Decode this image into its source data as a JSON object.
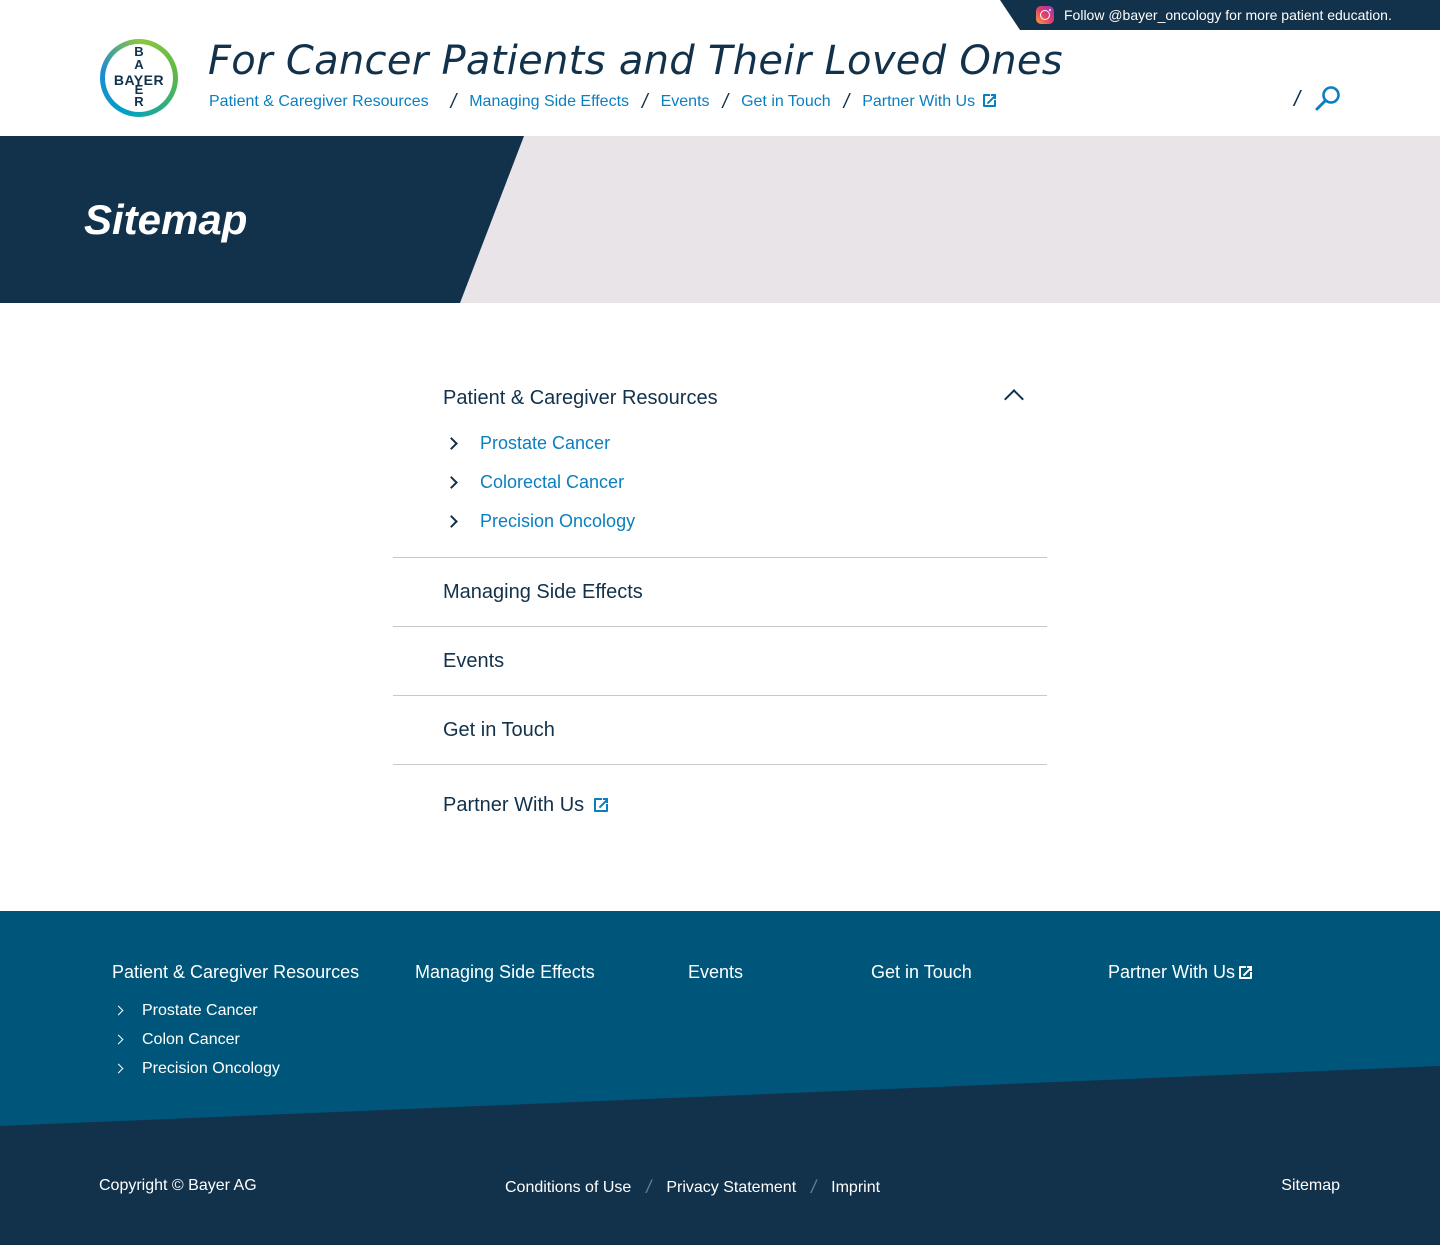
{
  "social": {
    "text": "Follow @bayer_oncology for more patient education."
  },
  "logo": {
    "horizontal": "BAYER",
    "vertical": "B A Y E R"
  },
  "site_title": "For Cancer Patients and Their Loved Ones",
  "nav": {
    "items": [
      "Patient & Caregiver Resources",
      "Managing Side Effects",
      "Events",
      "Get in Touch",
      "Partner With Us"
    ],
    "separator": "/"
  },
  "hero": {
    "title": "Sitemap"
  },
  "sitemap": {
    "sections": [
      {
        "title": "Patient & Caregiver Resources",
        "expanded": true,
        "children": [
          "Prostate Cancer",
          "Colorectal Cancer",
          "Precision Oncology"
        ]
      },
      {
        "title": "Managing Side Effects"
      },
      {
        "title": "Events"
      },
      {
        "title": "Get in Touch"
      },
      {
        "title": "Partner With Us",
        "external": true
      }
    ]
  },
  "footer": {
    "columns": [
      "Patient & Caregiver Resources",
      "Managing Side Effects",
      "Events",
      "Get in Touch",
      "Partner With Us"
    ],
    "resources_children": [
      "Prostate Cancer",
      "Colon Cancer",
      "Precision Oncology"
    ],
    "copyright": "Copyright © Bayer AG",
    "legal": [
      "Conditions of Use",
      "Privacy Statement",
      "Imprint"
    ],
    "sitemap_link": "Sitemap"
  },
  "colors": {
    "navy": "#12314a",
    "link_blue": "#0a7fc0",
    "footer_teal": "#00567a",
    "hero_gray": "#e8e4e7"
  }
}
